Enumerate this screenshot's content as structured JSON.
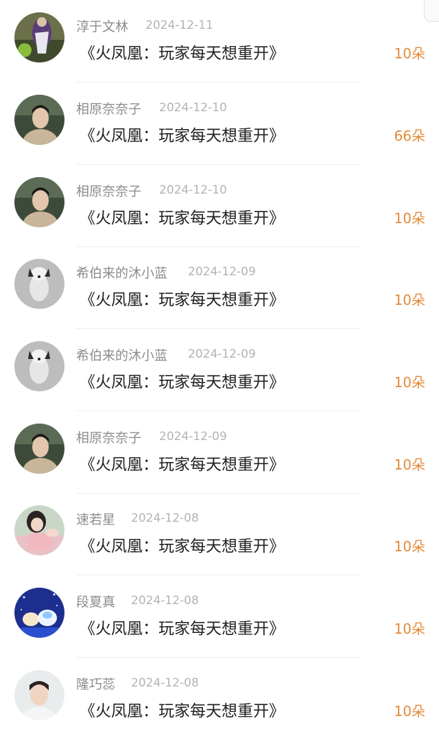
{
  "gifts": [
    {
      "name": "淳于文林",
      "date": "2024-12-11",
      "title": "《火凤凰：玩家每天想重开》",
      "amount": "10朵",
      "avatar": "person-outdoor-avatar"
    },
    {
      "name": "相原奈奈子",
      "date": "2024-12-10",
      "title": "《火凤凰：玩家每天想重开》",
      "amount": "66朵",
      "avatar": "man-portrait-avatar"
    },
    {
      "name": "相原奈奈子",
      "date": "2024-12-10",
      "title": "《火凤凰：玩家每天想重开》",
      "amount": "10朵",
      "avatar": "man-portrait-avatar"
    },
    {
      "name": "希伯来的沐小蓝",
      "date": "2024-12-09",
      "title": "《火凤凰：玩家每天想重开》",
      "amount": "10朵",
      "avatar": "dog-avatar"
    },
    {
      "name": "希伯来的沐小蓝",
      "date": "2024-12-09",
      "title": "《火凤凰：玩家每天想重开》",
      "amount": "10朵",
      "avatar": "dog-avatar"
    },
    {
      "name": "相原奈奈子",
      "date": "2024-12-09",
      "title": "《火凤凰：玩家每天想重开》",
      "amount": "10朵",
      "avatar": "man-portrait-avatar"
    },
    {
      "name": "速若星",
      "date": "2024-12-08",
      "title": "《火凤凰：玩家每天想重开》",
      "amount": "10朵",
      "avatar": "girl-avatar"
    },
    {
      "name": "段夏真",
      "date": "2024-12-08",
      "title": "《火凤凰：玩家每天想重开》",
      "amount": "10朵",
      "avatar": "cartoon-night-avatar"
    },
    {
      "name": "隆巧蕊",
      "date": "2024-12-08",
      "title": "《火凤凰：玩家每天想重开》",
      "amount": "10朵",
      "avatar": "young-man-avatar"
    }
  ],
  "colors": {
    "amount": "#e38a3a",
    "name": "#8c8c8c",
    "date": "#b3b3b3",
    "title": "#222222"
  }
}
